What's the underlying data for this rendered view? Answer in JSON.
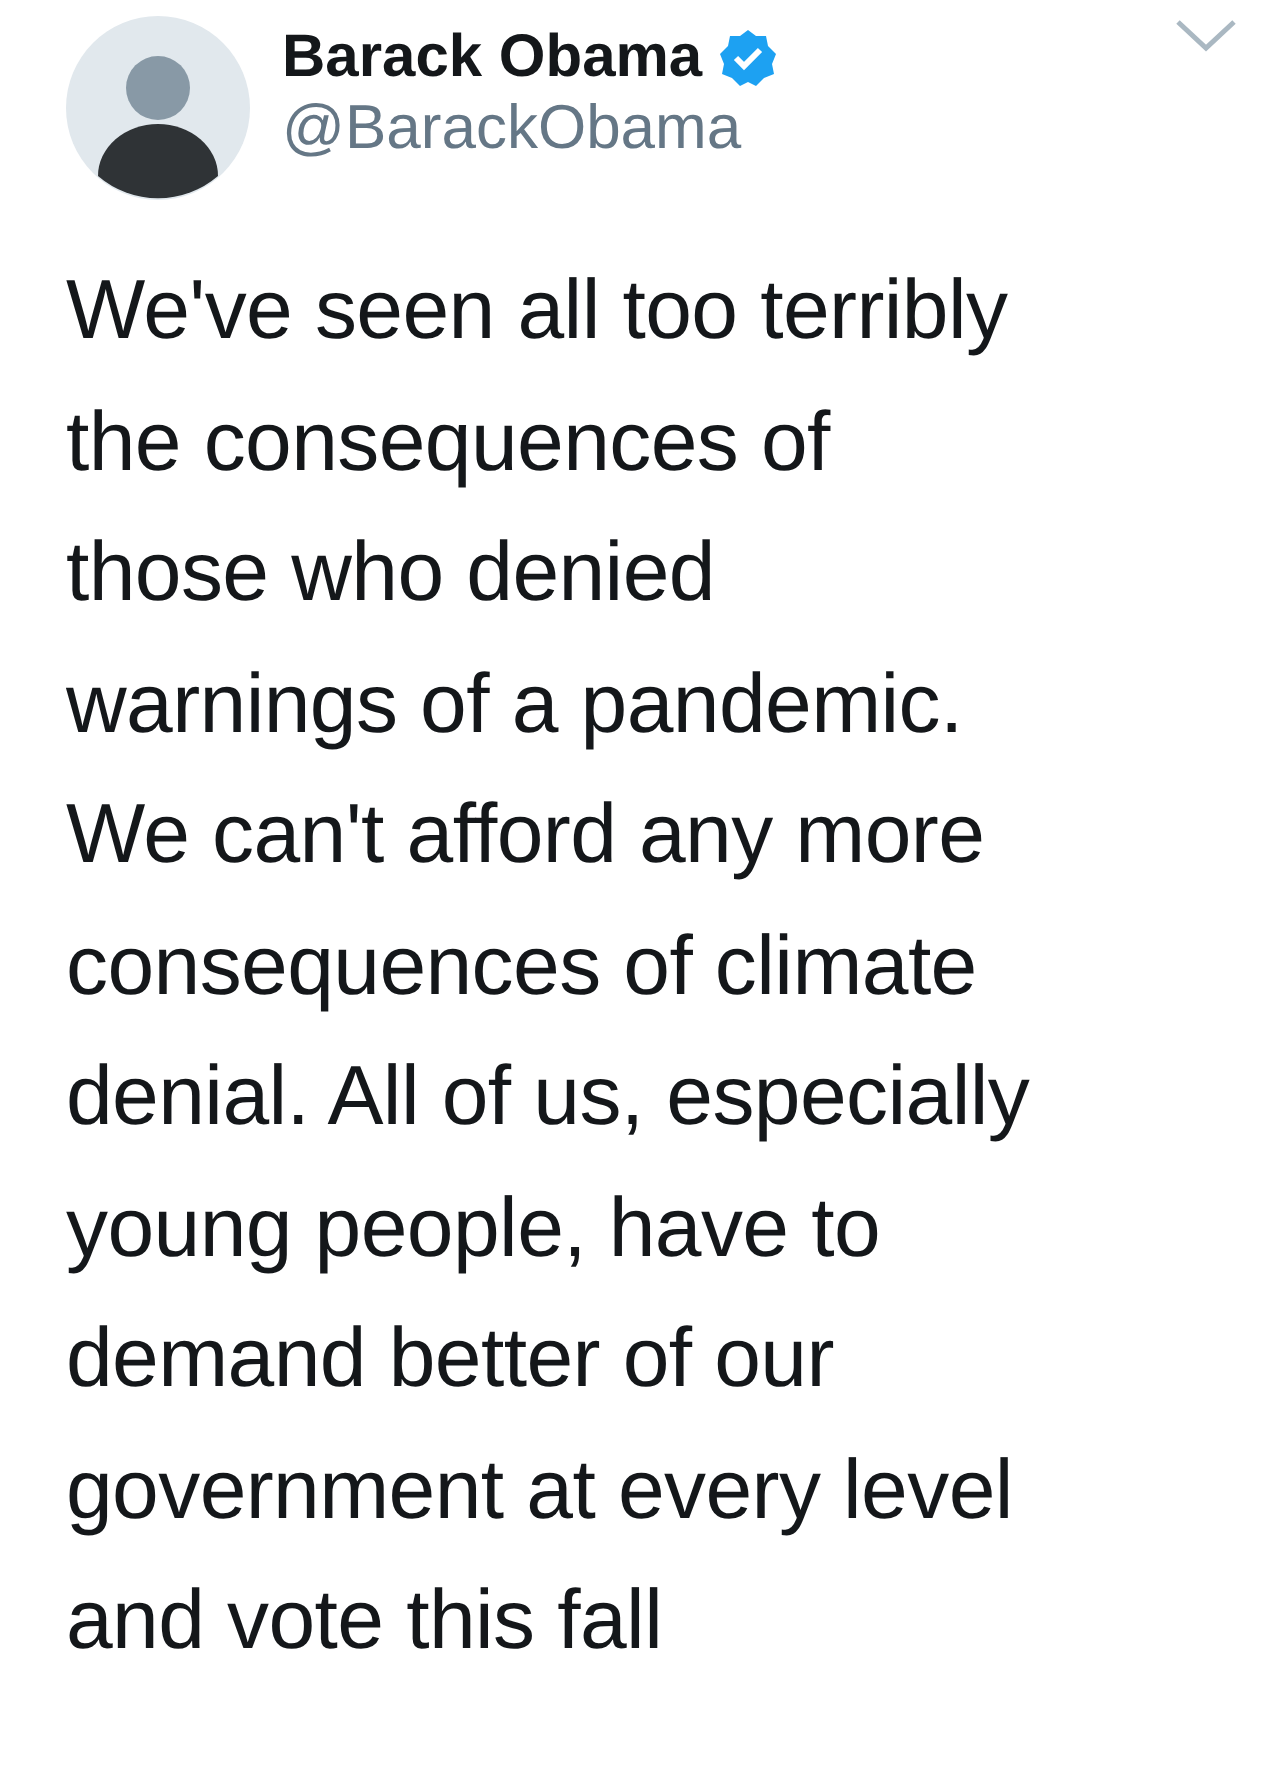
{
  "author": {
    "name": "Barack Obama",
    "verified": true,
    "handle": "@BarackObama"
  },
  "tweet": {
    "lines": [
      "We've seen all too terribly",
      "the consequences of",
      "those who denied",
      "warnings of a pandemic.",
      "We can't afford any more",
      "consequences of climate",
      "denial. All of us, especially",
      "young people, have to",
      "demand better of our",
      "government at every level",
      "and vote this fall"
    ]
  }
}
